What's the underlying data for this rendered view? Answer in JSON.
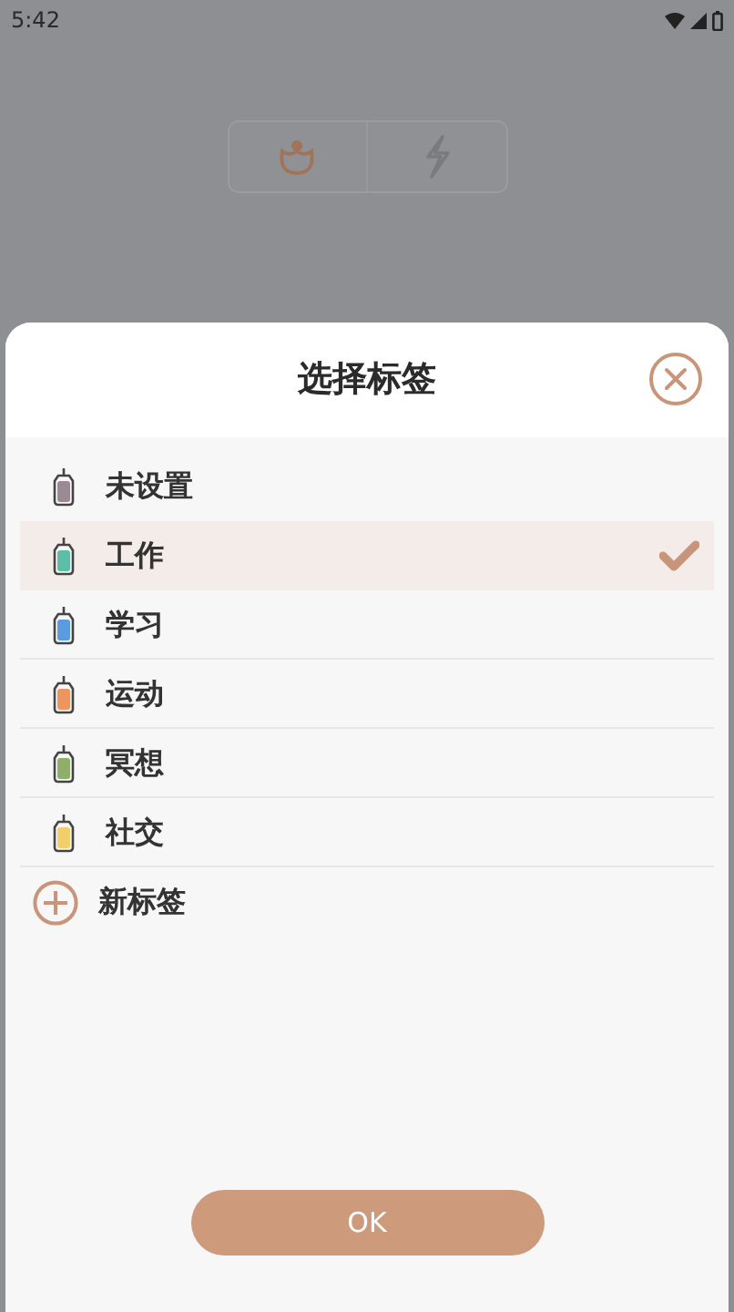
{
  "status_bar": {
    "time": "5:42"
  },
  "mode_switch": [
    {
      "kind": "timer",
      "selected": true
    },
    {
      "kind": "flash",
      "selected": false
    }
  ],
  "sheet": {
    "title": "选择标签",
    "items": [
      {
        "kind": "tag",
        "label": "未设置",
        "color": "#9b8a93",
        "selected": false
      },
      {
        "kind": "tag",
        "label": "工作",
        "color": "#5cbfa5",
        "selected": true
      },
      {
        "kind": "tag",
        "label": "学习",
        "color": "#5b9be0",
        "selected": false
      },
      {
        "kind": "tag",
        "label": "运动",
        "color": "#f0945f",
        "selected": false
      },
      {
        "kind": "tag",
        "label": "冥想",
        "color": "#8fae6a",
        "selected": false
      },
      {
        "kind": "tag",
        "label": "社交",
        "color": "#f2cf6a",
        "selected": false
      },
      {
        "kind": "add",
        "label": "新标签"
      }
    ],
    "ok_button": "OK"
  }
}
